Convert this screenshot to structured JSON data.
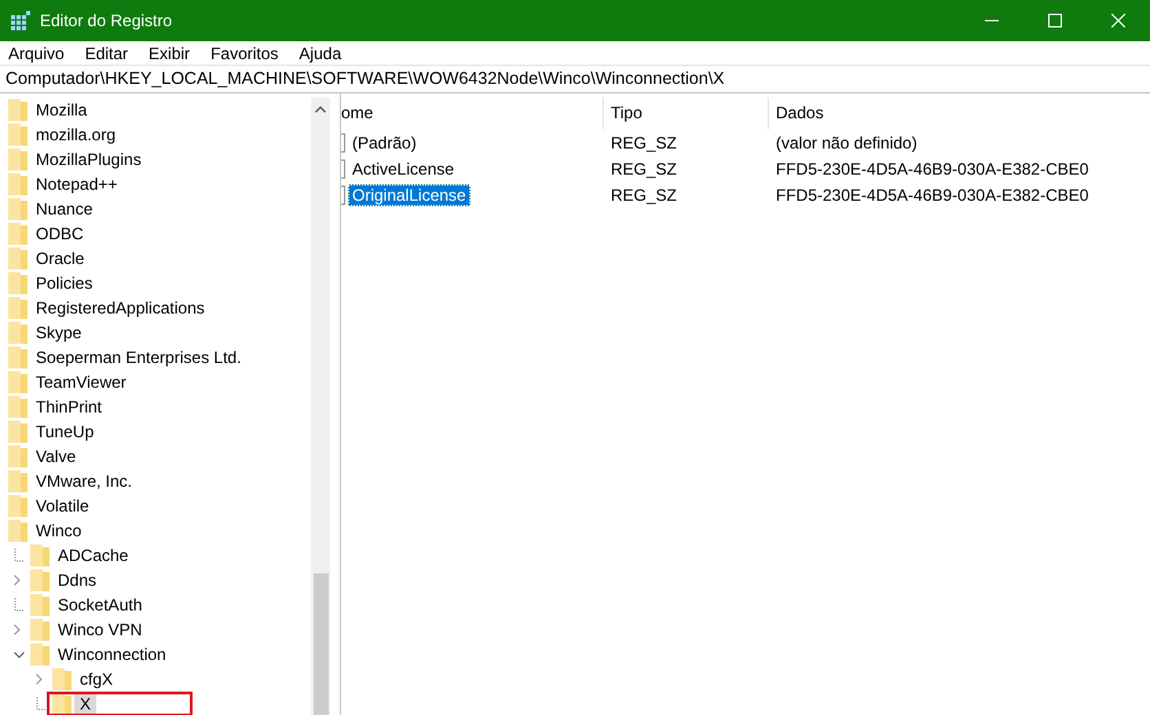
{
  "window": {
    "title": "Editor do Registro"
  },
  "menu": [
    "Arquivo",
    "Editar",
    "Exibir",
    "Favoritos",
    "Ajuda"
  ],
  "address": "Computador\\HKEY_LOCAL_MACHINE\\SOFTWARE\\WOW6432Node\\Winco\\Winconnection\\X",
  "tree": [
    {
      "label": "Mozilla",
      "selected": false
    },
    {
      "label": "mozilla.org",
      "selected": false
    },
    {
      "label": "MozillaPlugins",
      "selected": false
    },
    {
      "label": "Notepad++",
      "selected": false
    },
    {
      "label": "Nuance",
      "selected": false
    },
    {
      "label": "ODBC",
      "selected": false
    },
    {
      "label": "Oracle",
      "selected": false
    },
    {
      "label": "Policies",
      "selected": false
    },
    {
      "label": "RegisteredApplications",
      "selected": false
    },
    {
      "label": "Skype",
      "selected": false
    },
    {
      "label": "Soeperman Enterprises Ltd.",
      "selected": false
    },
    {
      "label": "TeamViewer",
      "selected": false
    },
    {
      "label": "ThinPrint",
      "selected": false
    },
    {
      "label": "TuneUp",
      "selected": false
    },
    {
      "label": "Valve",
      "selected": false
    },
    {
      "label": "VMware, Inc.",
      "selected": false
    },
    {
      "label": "Volatile",
      "selected": false
    },
    {
      "label": "Winco",
      "selected": false,
      "children": [
        {
          "label": "ADCache",
          "selected": false
        },
        {
          "label": "Ddns",
          "selected": false,
          "expanded": false
        },
        {
          "label": "SocketAuth",
          "selected": false
        },
        {
          "label": "Winco VPN",
          "selected": false,
          "expanded": false
        },
        {
          "label": "Winconnection",
          "selected": false,
          "expanded": true,
          "children": [
            {
              "label": "cfgX",
              "selected": false,
              "expanded": false
            },
            {
              "label": "X",
              "selected": true,
              "highlighted": true
            }
          ]
        }
      ]
    }
  ],
  "columns": [
    "ome",
    "Tipo",
    "Dados"
  ],
  "values": [
    {
      "name": "(Padrão)",
      "type": "REG_SZ",
      "data": "(valor não definido)",
      "selected": false
    },
    {
      "name": "ActiveLicense",
      "type": "REG_SZ",
      "data": "FFD5-230E-4D5A-46B9-030A-E382-CBE0",
      "selected": false
    },
    {
      "name": "OriginalLicense",
      "type": "REG_SZ",
      "data": "FFD5-230E-4D5A-46B9-030A-E382-CBE0",
      "selected": true
    }
  ]
}
